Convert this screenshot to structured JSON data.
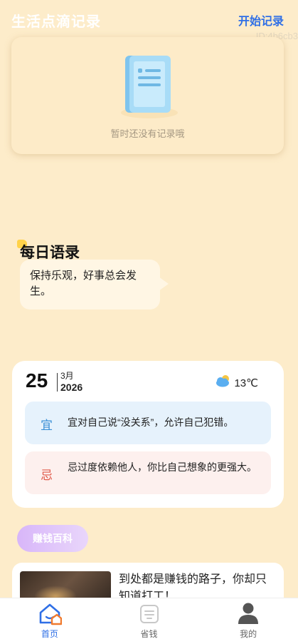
{
  "header": {
    "title": "生活点滴记录",
    "action_label": "开始记录",
    "id_label": "ID:4b6cb3"
  },
  "empty_state": {
    "icon": "document-icon",
    "message": "暂时还没有记录哦"
  },
  "daily_quote": {
    "title": "每日语录",
    "text": "保持乐观，好事总会发生。"
  },
  "calendar": {
    "day": "25",
    "month": "3月",
    "year": "2026",
    "weather_icon": "cloud-sun-icon",
    "temperature": "13℃",
    "yi_char": "宜",
    "yi_text": "宜对自己说“没关系”，允许自己犯错。",
    "ji_char": "忌",
    "ji_text": "忌过度依赖他人，你比自己想象的更强大。"
  },
  "section": {
    "label": "赚钱百科"
  },
  "article": {
    "title": "到处都是赚钱的路子，你却只知道打工！"
  },
  "tabs": [
    {
      "label": "首页",
      "icon": "home-icon",
      "active": true
    },
    {
      "label": "省钱",
      "icon": "wallet-icon",
      "active": false
    },
    {
      "label": "我的",
      "icon": "profile-icon",
      "active": false
    }
  ],
  "colors": {
    "background": "#fdecca",
    "accent": "#2f6fe6",
    "yi": "#3a8fd6",
    "ji": "#e05a4a"
  }
}
